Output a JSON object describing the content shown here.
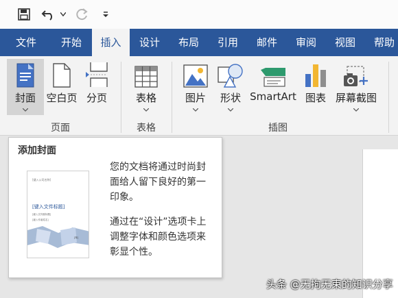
{
  "quick_access": {
    "icons": [
      "save-icon",
      "undo-icon",
      "undo-dropdown-icon",
      "redo-icon",
      "customize-icon"
    ]
  },
  "tabs": [
    "文件",
    "开始",
    "插入",
    "设计",
    "布局",
    "引用",
    "邮件",
    "审阅",
    "视图",
    "帮助"
  ],
  "active_tab": "插入",
  "ribbon": {
    "groups": {
      "page": "页面",
      "table": "表格",
      "illustrations": "插图"
    },
    "commands": {
      "cover": "封面",
      "blank_page": "空白页",
      "page_break": "分页",
      "table": "表格",
      "picture": "图片",
      "shapes": "形状",
      "smartart": "SmartArt",
      "chart": "图表",
      "screenshot": "屏幕截图"
    }
  },
  "tooltip": {
    "title": "添加封面",
    "para1": [
      "您的文档将通过时尚封",
      "面给人留下良好的第一",
      "印象。"
    ],
    "para2": [
      "通过在“设计”选项卡上",
      "调整字体和颜色选项来",
      "彰显个性。"
    ],
    "thumb": {
      "line1": "[键入公司名称]",
      "title": "[键入文件标题]",
      "subtitle": "[键入文件副标题]",
      "line4": "[键入作者姓名]",
      "year": "[年]"
    }
  },
  "watermark": "头条 @无拘无束的知识分享",
  "colors": {
    "accent": "#2b579a",
    "ribbon_bg": "#f3f3f3",
    "doc_bg": "#e6e6e6"
  }
}
